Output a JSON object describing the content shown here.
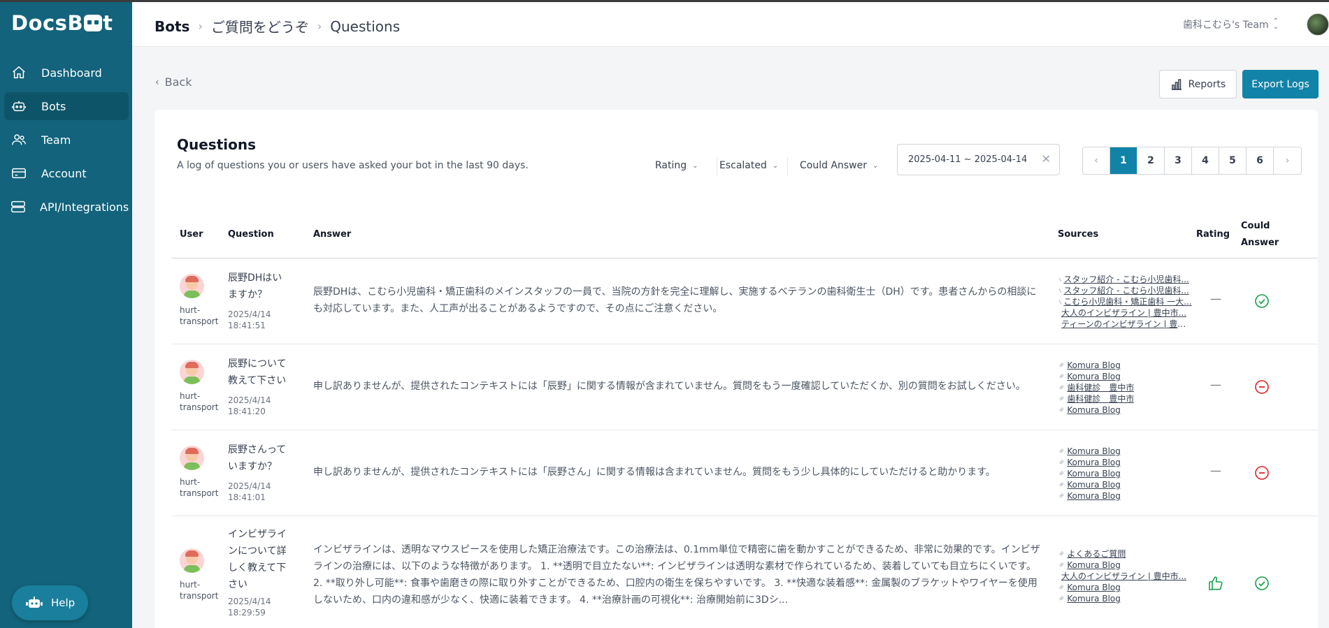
{
  "sidebar": {
    "logo": {
      "left": "Docs",
      "right": "B",
      "right2": "t"
    },
    "items": [
      {
        "label": "Dashboard",
        "icon": "home-icon"
      },
      {
        "label": "Bots",
        "icon": "robot-icon"
      },
      {
        "label": "Team",
        "icon": "users-icon"
      },
      {
        "label": "Account",
        "icon": "credit-card-icon"
      },
      {
        "label": "API/Integrations",
        "icon": "server-icon"
      }
    ],
    "help_label": "Help"
  },
  "header": {
    "crumbs": [
      "Bots",
      "ご質問をどうぞ",
      "Questions"
    ],
    "team": "歯科こむら's Team"
  },
  "toolbar": {
    "back_label": "Back",
    "reports_label": "Reports",
    "export_label": "Export Logs"
  },
  "card": {
    "title": "Questions",
    "subtitle": "A log of questions you or users have asked your bot in the last 90 days.",
    "filters": [
      "Rating",
      "Escalated",
      "Could Answer"
    ],
    "date_range": "2025-04-11 ~ 2025-04-14",
    "pages": [
      "1",
      "2",
      "3",
      "4",
      "5",
      "6"
    ],
    "current_page": "1"
  },
  "table": {
    "headers": {
      "user": "User",
      "question": "Question",
      "answer": "Answer",
      "sources": "Sources",
      "rating": "Rating",
      "could": "Could Answer"
    },
    "rows": [
      {
        "user": "hurt-transport",
        "question": "辰野DHはいますか？",
        "time": "2025/4/14 18:41:51",
        "answer": "辰野DHは、こむら小児歯科・矯正歯科のメインスタッフの一員で、当院の方針を完全に理解し、実施するベテランの歯科衛生士（DH）です。患者さんからの相談にも対応しています。また、人工声が出ることがあるようですので、その点にご注意ください。",
        "sources": [
          "スタッフ紹介 - こむら小児歯科...",
          "スタッフ紹介 - こむら小児歯科...",
          "こむら小児歯科・矯正歯科 一大...",
          "大人のインビザライン | 豊中市...",
          "ティーンのインビザライン | 豊中..."
        ],
        "rating": "—",
        "could_answer": "yes"
      },
      {
        "user": "hurt-transport",
        "question": "辰野について教えて下さい",
        "time": "2025/4/14 18:41:20",
        "answer": "申し訳ありませんが、提供されたコンテキストには「辰野」に関する情報が含まれていません。質問をもう一度確認していただくか、別の質問をお試しください。",
        "sources": [
          "Komura Blog",
          "Komura Blog",
          "歯科健診　豊中市",
          "歯科健診　豊中市",
          "Komura Blog"
        ],
        "rating": "—",
        "could_answer": "no"
      },
      {
        "user": "hurt-transport",
        "question": "辰野さんっていますか？",
        "time": "2025/4/14 18:41:01",
        "answer": "申し訳ありませんが、提供されたコンテキストには「辰野さん」に関する情報は含まれていません。質問をもう少し具体的にしていただけると助かります。",
        "sources": [
          "Komura Blog",
          "Komura Blog",
          "Komura Blog",
          "Komura Blog",
          "Komura Blog"
        ],
        "rating": "—",
        "could_answer": "no"
      },
      {
        "user": "hurt-transport",
        "question": "インビザラインについて詳しく教えて下さい",
        "time": "2025/4/14 18:29:59",
        "answer": "インビザラインは、透明なマウスピースを使用した矯正治療法です。この治療法は、0.1mm単位で精密に歯を動かすことができるため、非常に効果的です。インビザラインの治療には、以下のような特徴があります。 1. **透明で目立たない**: インビザラインは透明な素材で作られているため、装着していても目立ちにくいです。 2. **取り外し可能**: 食事や歯磨きの際に取り外すことができるため、口腔内の衛生を保ちやすいです。 3. **快適な装着感**: 金属製のブラケットやワイヤーを使用しないため、口内の違和感が少なく、快適に装着できます。 4. **治療計画の可視化**: 治療開始前に3Dシ...",
        "sources": [
          "よくあるご質問",
          "Komura Blog",
          "大人のインビザライン | 豊中市...",
          "Komura Blog",
          "Komura Blog"
        ],
        "rating": "thumbs-up",
        "could_answer": "yes"
      }
    ]
  },
  "colors": {
    "sidebar": "#12637b",
    "accent": "#1283a8",
    "ok": "#16a34a",
    "bad": "#dc2626"
  }
}
